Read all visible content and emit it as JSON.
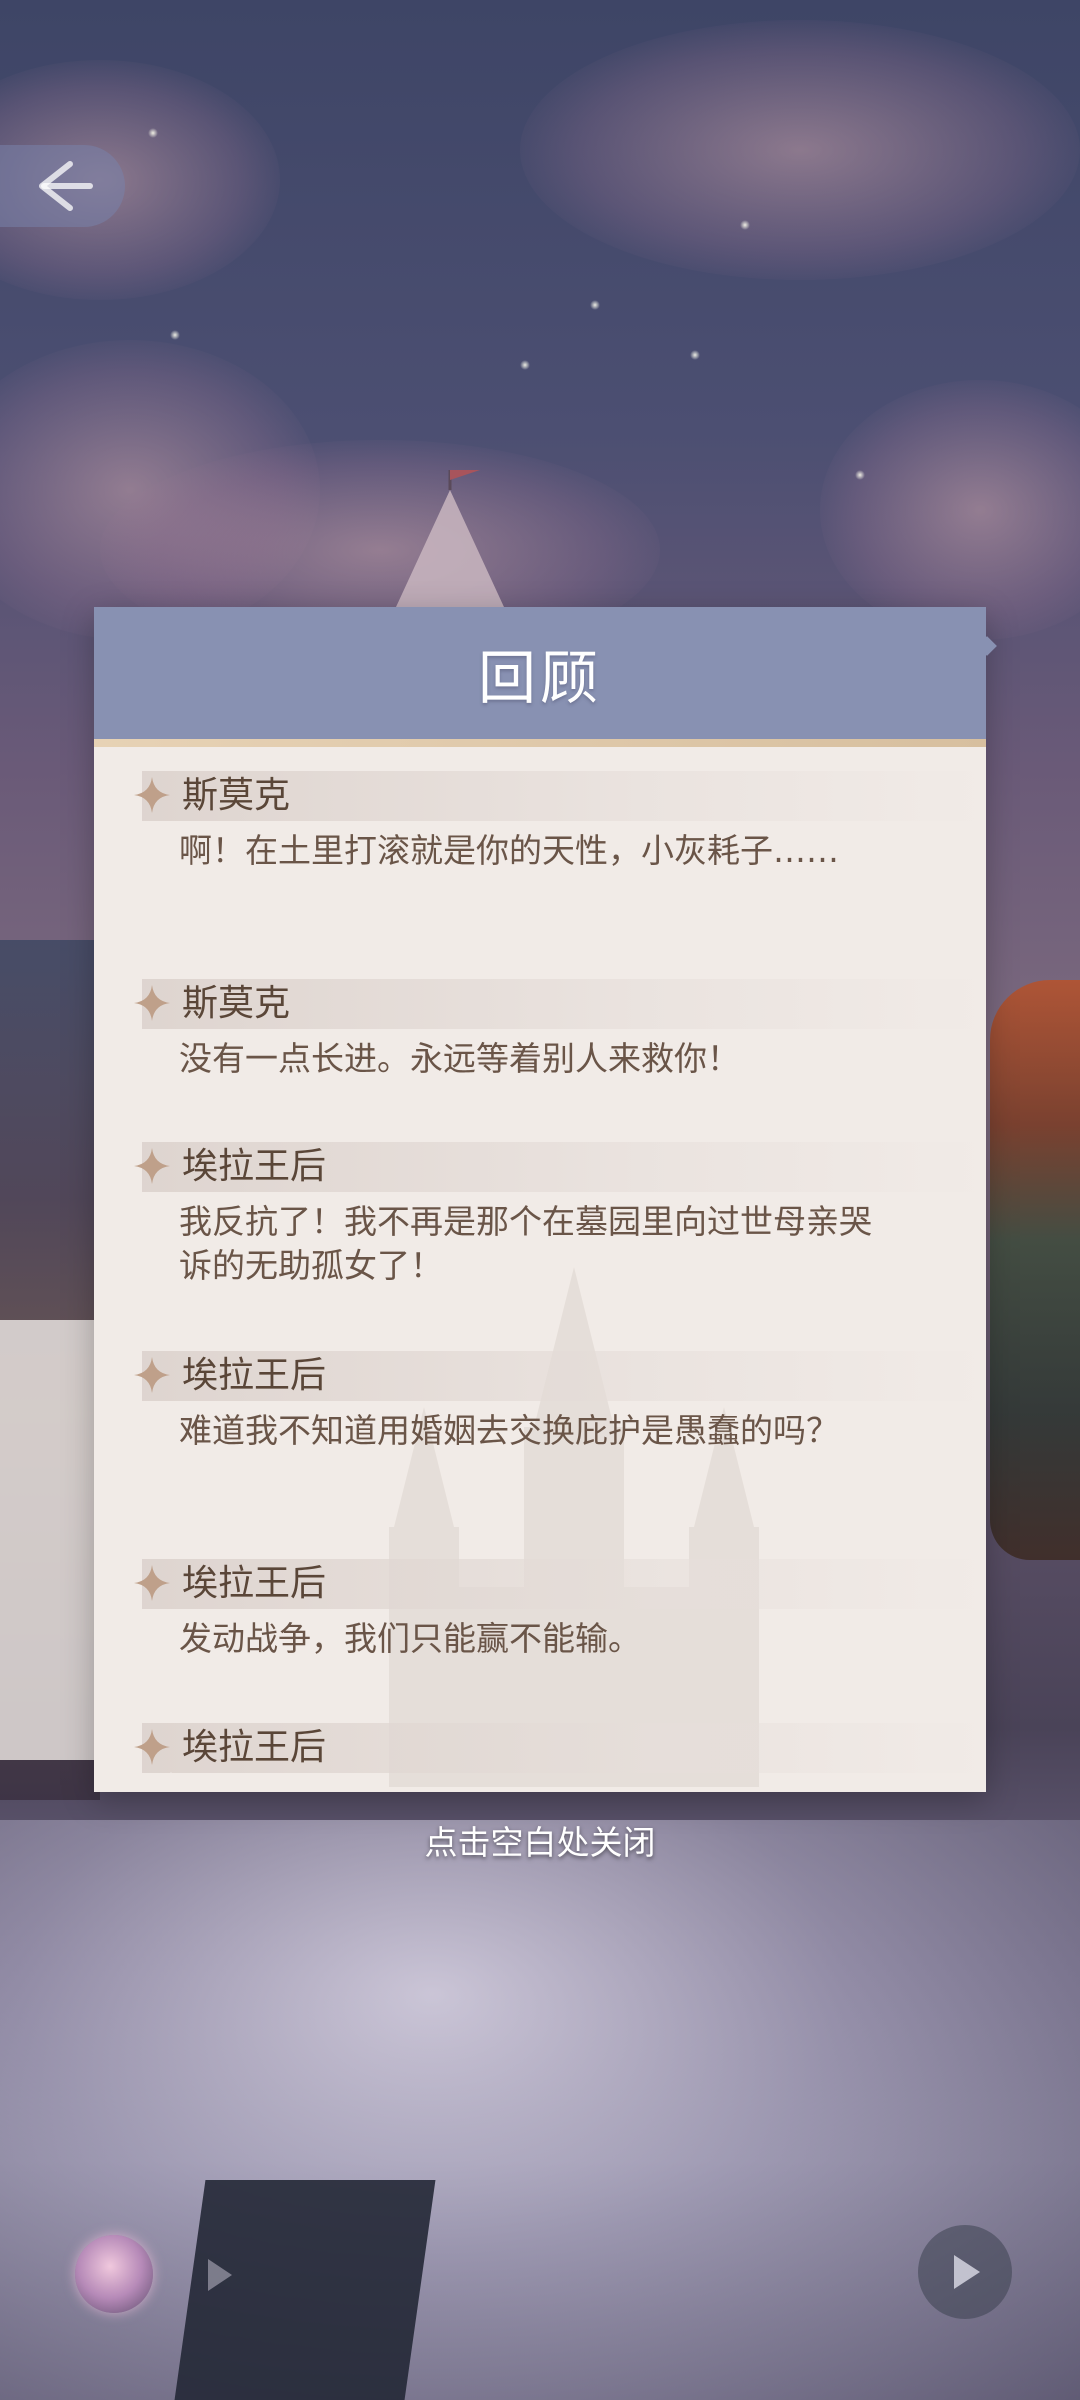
{
  "panel": {
    "title": "回顾",
    "close_hint": "点击空白处关闭"
  },
  "entries": [
    {
      "speaker": "斯莫克",
      "text": "啊！在土里打滚就是你的天性，小灰耗子……"
    },
    {
      "speaker": "斯莫克",
      "text": "没有一点长进。永远等着别人来救你！"
    },
    {
      "speaker": "埃拉王后",
      "text": "我反抗了！我不再是那个在墓园里向过世母亲哭诉的无助孤女了！"
    },
    {
      "speaker": "埃拉王后",
      "text": "难道我不知道用婚姻去交换庇护是愚蠢的吗？"
    },
    {
      "speaker": "埃拉王后",
      "text": "发动战争，我们只能赢不能输。"
    },
    {
      "speaker": "埃拉王后",
      "text": ""
    }
  ],
  "icons": {
    "back": "back-arrow-icon",
    "speaker_marker": "four-point-star-icon",
    "play": "play-icon",
    "forward": "forward-icon"
  },
  "colors": {
    "header_bg": "#8891b2",
    "panel_bg": "#f1ebe7",
    "speaker_text": "#5a4638",
    "line_text": "#6a5548",
    "accent_gold": "#bfa08a"
  }
}
